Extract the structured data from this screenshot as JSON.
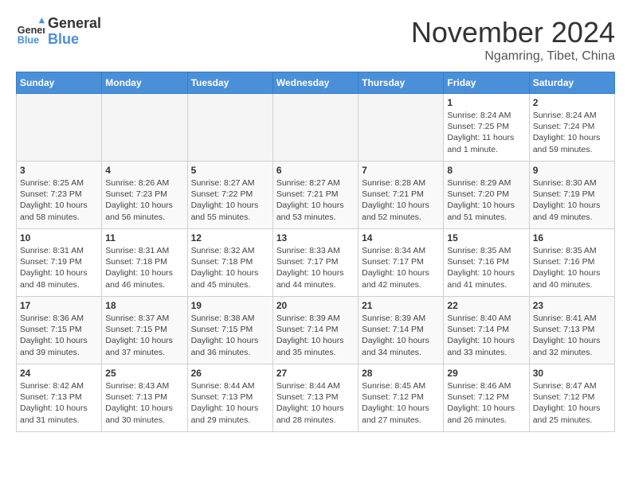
{
  "header": {
    "logo_general": "General",
    "logo_blue": "Blue",
    "month_title": "November 2024",
    "location": "Ngamring, Tibet, China"
  },
  "days_of_week": [
    "Sunday",
    "Monday",
    "Tuesday",
    "Wednesday",
    "Thursday",
    "Friday",
    "Saturday"
  ],
  "weeks": [
    [
      {
        "day": "",
        "empty": true
      },
      {
        "day": "",
        "empty": true
      },
      {
        "day": "",
        "empty": true
      },
      {
        "day": "",
        "empty": true
      },
      {
        "day": "",
        "empty": true
      },
      {
        "day": "1",
        "sunrise": "8:24 AM",
        "sunset": "7:25 PM",
        "daylight": "11 hours and 1 minute."
      },
      {
        "day": "2",
        "sunrise": "8:24 AM",
        "sunset": "7:24 PM",
        "daylight": "10 hours and 59 minutes."
      }
    ],
    [
      {
        "day": "3",
        "sunrise": "8:25 AM",
        "sunset": "7:23 PM",
        "daylight": "10 hours and 58 minutes."
      },
      {
        "day": "4",
        "sunrise": "8:26 AM",
        "sunset": "7:23 PM",
        "daylight": "10 hours and 56 minutes."
      },
      {
        "day": "5",
        "sunrise": "8:27 AM",
        "sunset": "7:22 PM",
        "daylight": "10 hours and 55 minutes."
      },
      {
        "day": "6",
        "sunrise": "8:27 AM",
        "sunset": "7:21 PM",
        "daylight": "10 hours and 53 minutes."
      },
      {
        "day": "7",
        "sunrise": "8:28 AM",
        "sunset": "7:21 PM",
        "daylight": "10 hours and 52 minutes."
      },
      {
        "day": "8",
        "sunrise": "8:29 AM",
        "sunset": "7:20 PM",
        "daylight": "10 hours and 51 minutes."
      },
      {
        "day": "9",
        "sunrise": "8:30 AM",
        "sunset": "7:19 PM",
        "daylight": "10 hours and 49 minutes."
      }
    ],
    [
      {
        "day": "10",
        "sunrise": "8:31 AM",
        "sunset": "7:19 PM",
        "daylight": "10 hours and 48 minutes."
      },
      {
        "day": "11",
        "sunrise": "8:31 AM",
        "sunset": "7:18 PM",
        "daylight": "10 hours and 46 minutes."
      },
      {
        "day": "12",
        "sunrise": "8:32 AM",
        "sunset": "7:18 PM",
        "daylight": "10 hours and 45 minutes."
      },
      {
        "day": "13",
        "sunrise": "8:33 AM",
        "sunset": "7:17 PM",
        "daylight": "10 hours and 44 minutes."
      },
      {
        "day": "14",
        "sunrise": "8:34 AM",
        "sunset": "7:17 PM",
        "daylight": "10 hours and 42 minutes."
      },
      {
        "day": "15",
        "sunrise": "8:35 AM",
        "sunset": "7:16 PM",
        "daylight": "10 hours and 41 minutes."
      },
      {
        "day": "16",
        "sunrise": "8:35 AM",
        "sunset": "7:16 PM",
        "daylight": "10 hours and 40 minutes."
      }
    ],
    [
      {
        "day": "17",
        "sunrise": "8:36 AM",
        "sunset": "7:15 PM",
        "daylight": "10 hours and 39 minutes."
      },
      {
        "day": "18",
        "sunrise": "8:37 AM",
        "sunset": "7:15 PM",
        "daylight": "10 hours and 37 minutes."
      },
      {
        "day": "19",
        "sunrise": "8:38 AM",
        "sunset": "7:15 PM",
        "daylight": "10 hours and 36 minutes."
      },
      {
        "day": "20",
        "sunrise": "8:39 AM",
        "sunset": "7:14 PM",
        "daylight": "10 hours and 35 minutes."
      },
      {
        "day": "21",
        "sunrise": "8:39 AM",
        "sunset": "7:14 PM",
        "daylight": "10 hours and 34 minutes."
      },
      {
        "day": "22",
        "sunrise": "8:40 AM",
        "sunset": "7:14 PM",
        "daylight": "10 hours and 33 minutes."
      },
      {
        "day": "23",
        "sunrise": "8:41 AM",
        "sunset": "7:13 PM",
        "daylight": "10 hours and 32 minutes."
      }
    ],
    [
      {
        "day": "24",
        "sunrise": "8:42 AM",
        "sunset": "7:13 PM",
        "daylight": "10 hours and 31 minutes."
      },
      {
        "day": "25",
        "sunrise": "8:43 AM",
        "sunset": "7:13 PM",
        "daylight": "10 hours and 30 minutes."
      },
      {
        "day": "26",
        "sunrise": "8:44 AM",
        "sunset": "7:13 PM",
        "daylight": "10 hours and 29 minutes."
      },
      {
        "day": "27",
        "sunrise": "8:44 AM",
        "sunset": "7:13 PM",
        "daylight": "10 hours and 28 minutes."
      },
      {
        "day": "28",
        "sunrise": "8:45 AM",
        "sunset": "7:12 PM",
        "daylight": "10 hours and 27 minutes."
      },
      {
        "day": "29",
        "sunrise": "8:46 AM",
        "sunset": "7:12 PM",
        "daylight": "10 hours and 26 minutes."
      },
      {
        "day": "30",
        "sunrise": "8:47 AM",
        "sunset": "7:12 PM",
        "daylight": "10 hours and 25 minutes."
      }
    ]
  ],
  "labels": {
    "sunrise": "Sunrise:",
    "sunset": "Sunset:",
    "daylight": "Daylight:"
  }
}
